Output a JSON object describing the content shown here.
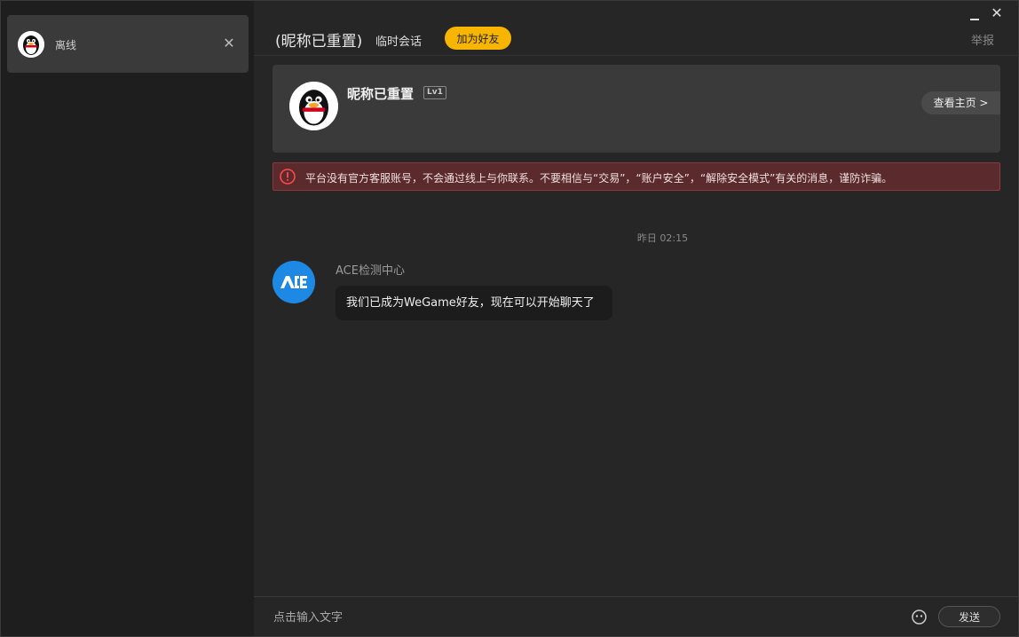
{
  "sidebar": {
    "conversations": [
      {
        "status": "离线",
        "avatar_icon": "qq-penguin-icon"
      }
    ]
  },
  "header": {
    "title_name": "(昵称已重置)",
    "title_type": "临时会话",
    "add_friend_label": "加为好友",
    "report_label": "举报"
  },
  "profile": {
    "name": "昵称已重置",
    "level": "Lv1",
    "view_home_label": "查看主页 >"
  },
  "warning": {
    "text": "平台没有官方客服账号，不会通过线上与你联系。不要相信与“交易”，“账户安全”，“解除安全模式”有关的消息，谨防诈骗。"
  },
  "chat": {
    "timestamp": "昨日 02:15",
    "messages": [
      {
        "sender": "ACE检测中心",
        "text": "我们已成为WeGame好友，现在可以开始聊天了"
      }
    ]
  },
  "input": {
    "placeholder": "点击输入文字",
    "send_label": "发送"
  },
  "colors": {
    "accent": "#f7b500",
    "warning_bg": "#5a2a2c",
    "ace_blue": "#1e88e5"
  }
}
